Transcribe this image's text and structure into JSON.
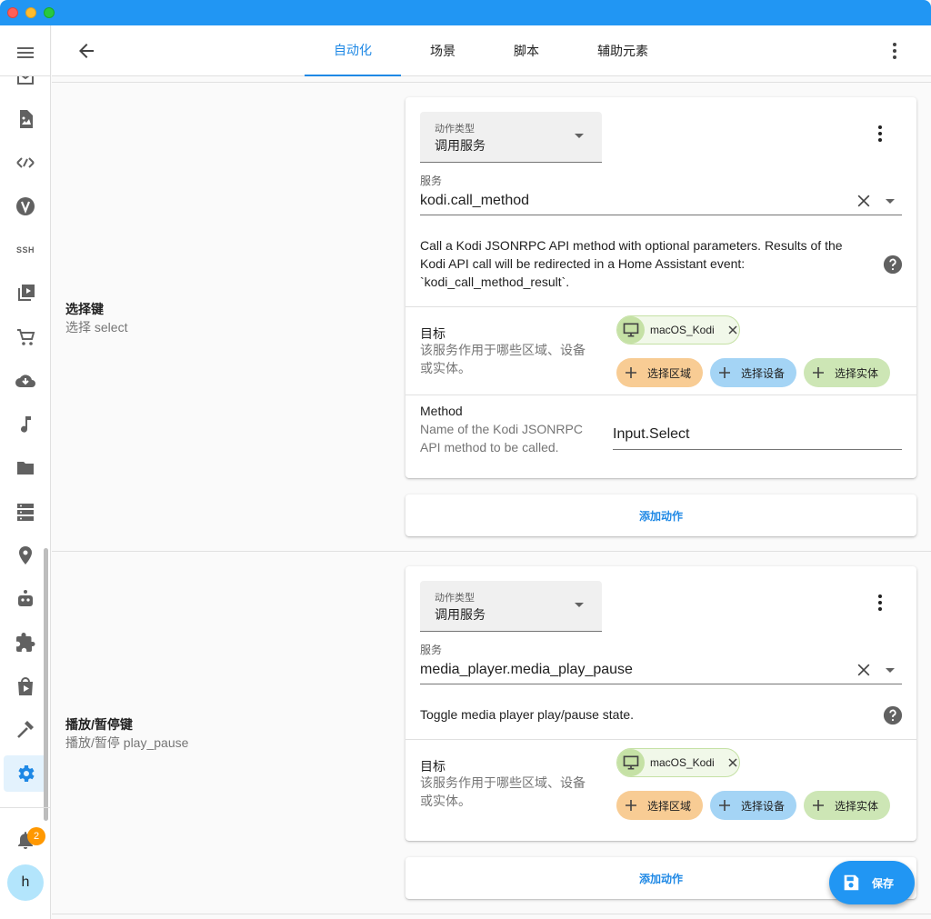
{
  "colors": {
    "titlebar": "#2196f3",
    "accent": "#1e88e5",
    "area_chip": "#f8cc94",
    "device_chip": "#a4d4f5",
    "entity_chip": "#cde6b5",
    "badge": "#ff9800"
  },
  "sidebar": {
    "menu_icon": "menu-icon",
    "items": [
      {
        "icon": "mailbox-icon"
      },
      {
        "icon": "file-image-icon"
      },
      {
        "icon": "code-braces-icon"
      },
      {
        "icon": "vscode-v-icon"
      },
      {
        "icon": "ssh-icon",
        "label": "SSH"
      },
      {
        "icon": "play-box-multiple-icon"
      },
      {
        "icon": "cart-icon"
      },
      {
        "icon": "cloud-download-icon"
      },
      {
        "icon": "music-note-icon"
      },
      {
        "icon": "folder-icon"
      },
      {
        "icon": "server-icon"
      },
      {
        "icon": "map-marker-icon"
      },
      {
        "icon": "robot-icon"
      },
      {
        "icon": "puzzle-icon"
      },
      {
        "icon": "shopping-play-icon"
      },
      {
        "icon": "hammer-icon"
      },
      {
        "icon": "cog-icon"
      }
    ],
    "notification_count": "2",
    "avatar_initial": "h"
  },
  "topbar": {
    "tabs": [
      {
        "label": "自动化",
        "active": true
      },
      {
        "label": "场景",
        "active": false
      },
      {
        "label": "脚本",
        "active": false
      },
      {
        "label": "辅助元素",
        "active": false
      }
    ]
  },
  "sections": [
    {
      "title": "选择键",
      "subtitle": "选择 select",
      "action_type_label": "动作类型",
      "action_type_value": "调用服务",
      "service_label": "服务",
      "service_value": "kodi.call_method",
      "description": "Call a Kodi JSONRPC API method with optional parameters. Results of the Kodi API call will be redirected in a Home Assistant event: `kodi_call_method_result`.",
      "target_title": "目标",
      "target_desc": "该服务作用于哪些区域、设备或实体。",
      "entity_chip": "macOS_Kodi",
      "add_area": "选择区域",
      "add_device": "选择设备",
      "add_entity": "选择实体",
      "method_title": "Method",
      "method_desc": "Name of the Kodi JSONRPC API method to be called.",
      "method_value": "Input.Select",
      "add_action": "添加动作"
    },
    {
      "title": "播放/暂停键",
      "subtitle": "播放/暂停 play_pause",
      "action_type_label": "动作类型",
      "action_type_value": "调用服务",
      "service_label": "服务",
      "service_value": "media_player.media_play_pause",
      "description": "Toggle media player play/pause state.",
      "target_title": "目标",
      "target_desc": "该服务作用于哪些区域、设备或实体。",
      "entity_chip": "macOS_Kodi",
      "add_area": "选择区域",
      "add_device": "选择设备",
      "add_entity": "选择实体",
      "add_action": "添加动作"
    }
  ],
  "fab": {
    "label": "保存"
  }
}
